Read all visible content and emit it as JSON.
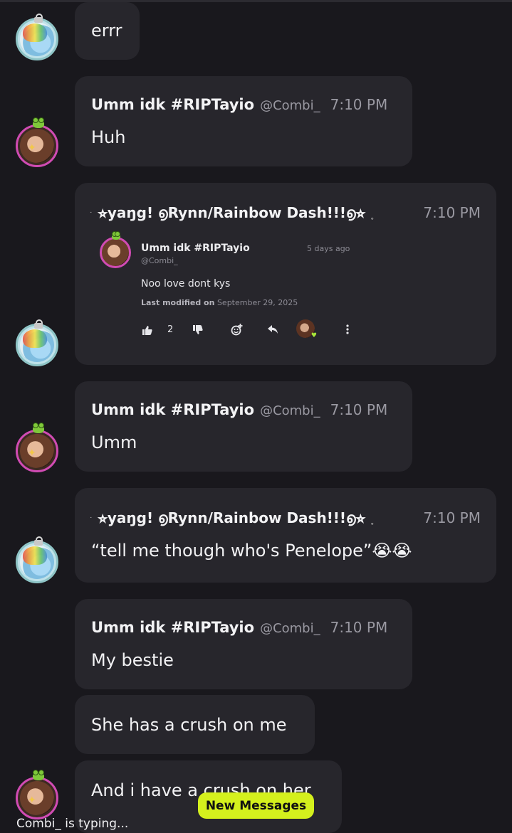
{
  "messages": [
    {
      "text": "errr"
    },
    {
      "author": "Umm idk #RIPTayio",
      "handle": "@Combi_",
      "time": "7:10 PM",
      "text": "Huh"
    },
    {
      "author_prefix": "˙",
      "author": "⭐︎yaŋg! ൭Rynn/Rainbow Dash!!!൭⭐︎",
      "author_suffix": "˳",
      "time": "7:10 PM",
      "embed": {
        "author": "Umm idk #RIPTayio",
        "handle": "@Combi_",
        "ago": "5 days ago",
        "body": "Noo love dont kys",
        "modified_label": "Last modified on",
        "modified_date": "September 29, 2025",
        "like_count": "2",
        "icons": [
          "thumbs-up-icon",
          "thumbs-down-icon",
          "add-reaction-icon",
          "reply-icon",
          "more-icon"
        ]
      }
    },
    {
      "author": "Umm idk #RIPTayio",
      "handle": "@Combi_",
      "time": "7:10 PM",
      "text": "Umm"
    },
    {
      "author_prefix": "˙",
      "author": "⭐︎yaŋg! ൭Rynn/Rainbow Dash!!!൭⭐︎",
      "author_suffix": "˳",
      "time": "7:10 PM",
      "text": "“tell me though who's Penelope”😭😭"
    },
    {
      "author": "Umm idk #RIPTayio",
      "handle": "@Combi_",
      "time": "7:10 PM",
      "text": "My bestie"
    },
    {
      "text": "She has a crush on me"
    },
    {
      "text": "And i have a crush on her"
    }
  ],
  "footer": {
    "typing": "Combi_ is typing...",
    "new_messages": "New Messages"
  },
  "colors": {
    "background": "#19181d",
    "bubble": "#27262c",
    "accent": "#d4f01d",
    "combi_ring": "#d04bb3",
    "rynn_ring": "#8ec4c6"
  }
}
